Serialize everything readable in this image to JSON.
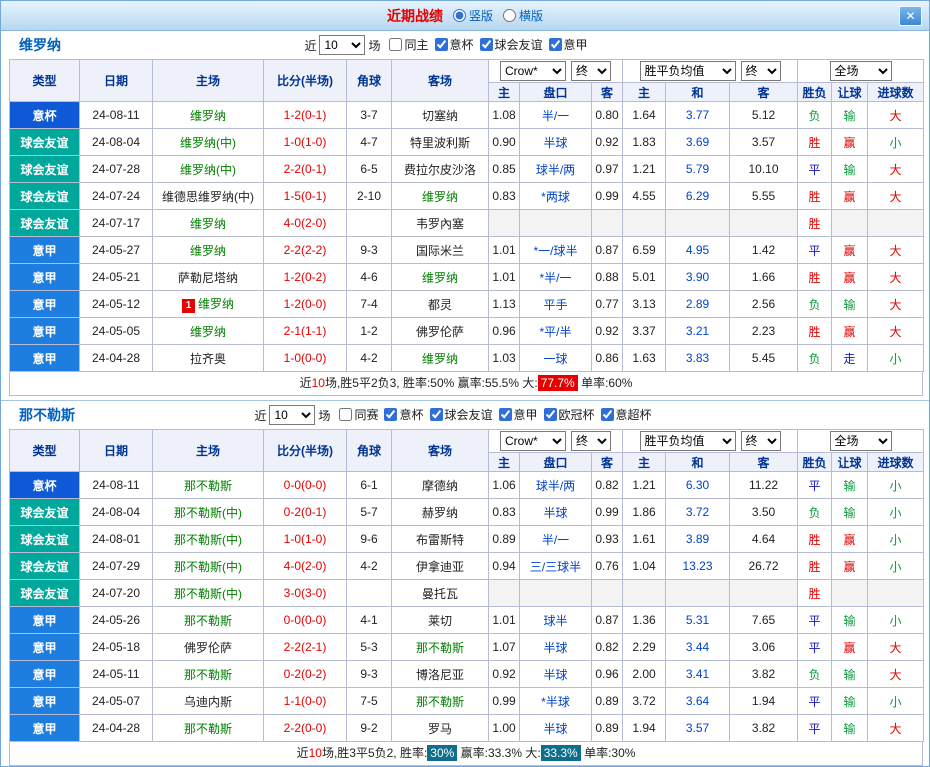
{
  "titlebar": {
    "title": "近期战绩",
    "radio_vertical": "竖版",
    "radio_horizontal": "横版",
    "close_glyph": "✕"
  },
  "columns": {
    "type": "类型",
    "date": "日期",
    "home": "主场",
    "score": "比分(半场)",
    "corner": "角球",
    "away": "客场",
    "odds_home": "主",
    "handicap": "盘口",
    "odds_away": "客",
    "avg_home": "主",
    "avg_draw": "和",
    "avg_away": "客",
    "result": "胜负",
    "handicap_result": "让球",
    "goals": "进球数"
  },
  "selects": {
    "crow": "Crow*",
    "final": "终",
    "avg": "胜平负均值",
    "scope": "全场"
  },
  "colors": {
    "type_bg": {
      "意杯": "#0f58d6",
      "球会友谊": "#00a79b",
      "意甲": "#1e7ee0"
    },
    "result": {
      "胜": "#e60000",
      "平": "#1414c8",
      "负": "#0a9a3c"
    },
    "hres": {
      "赢": "#e60000",
      "输": "#0a9a3c",
      "走": "#1414c8"
    },
    "goals": {
      "大": "#e60000",
      "小": "#0a9a3c"
    },
    "team_green": "#008000",
    "score_red": "#e60000",
    "highlight_red": "#e60000",
    "highlight_dark": "#0f6e8c"
  },
  "sections": [
    {
      "team": "维罗纳",
      "filter": {
        "near": "近",
        "count": "10",
        "games": "场",
        "checkboxes": [
          {
            "label": "同主",
            "checked": false
          },
          {
            "label": "意杯",
            "checked": true
          },
          {
            "label": "球会友谊",
            "checked": true
          },
          {
            "label": "意甲",
            "checked": true
          }
        ]
      },
      "rows": [
        {
          "type": "意杯",
          "date": "24-08-11",
          "home": "维罗纳",
          "hg": true,
          "score": "1-2(0-1)",
          "corner": "3-7",
          "away": "切塞纳",
          "o1": "1.08",
          "hc": "半/一",
          "o2": "0.80",
          "a1": "1.64",
          "a2": "3.77",
          "a3": "5.12",
          "res": "负",
          "hres": "输",
          "goal": "大"
        },
        {
          "type": "球会友谊",
          "date": "24-08-04",
          "home": "维罗纳(中)",
          "hg": true,
          "score": "1-0(1-0)",
          "corner": "4-7",
          "away": "特里波利斯",
          "o1": "0.90",
          "hc": "半球",
          "o2": "0.92",
          "a1": "1.83",
          "a2": "3.69",
          "a3": "3.57",
          "res": "胜",
          "hres": "赢",
          "goal": "小"
        },
        {
          "type": "球会友谊",
          "date": "24-07-28",
          "home": "维罗纳(中)",
          "hg": true,
          "score": "2-2(0-1)",
          "corner": "6-5",
          "away": "费拉尔皮沙洛",
          "o1": "0.85",
          "hc": "球半/两",
          "o2": "0.97",
          "a1": "1.21",
          "a2": "5.79",
          "a3": "10.10",
          "res": "平",
          "hres": "输",
          "goal": "大"
        },
        {
          "type": "球会友谊",
          "date": "24-07-24",
          "home": "维德思维罗纳(中)",
          "score": "1-5(0-1)",
          "corner": "2-10",
          "away": "维罗纳",
          "ag": true,
          "o1": "0.83",
          "hc": "*两球",
          "o2": "0.99",
          "a1": "4.55",
          "a2": "6.29",
          "a3": "5.55",
          "res": "胜",
          "hres": "赢",
          "goal": "大"
        },
        {
          "type": "球会友谊",
          "date": "24-07-17",
          "home": "维罗纳",
          "hg": true,
          "score": "4-0(2-0)",
          "corner": "",
          "away": "韦罗內塞",
          "o1": "",
          "hc": "",
          "o2": "",
          "a1": "",
          "a2": "",
          "a3": "",
          "res": "胜",
          "hres": "",
          "goal": ""
        },
        {
          "type": "意甲",
          "date": "24-05-27",
          "home": "维罗纳",
          "hg": true,
          "score": "2-2(2-2)",
          "corner": "9-3",
          "away": "国际米兰",
          "o1": "1.01",
          "hc": "*一/球半",
          "o2": "0.87",
          "a1": "6.59",
          "a2": "4.95",
          "a3": "1.42",
          "res": "平",
          "hres": "赢",
          "goal": "大"
        },
        {
          "type": "意甲",
          "date": "24-05-21",
          "home": "萨勒尼塔纳",
          "score": "1-2(0-2)",
          "corner": "4-6",
          "away": "维罗纳",
          "ag": true,
          "o1": "1.01",
          "hc": "*半/一",
          "o2": "0.88",
          "a1": "5.01",
          "a2": "3.90",
          "a3": "1.66",
          "res": "胜",
          "hres": "赢",
          "goal": "大"
        },
        {
          "type": "意甲",
          "date": "24-05-12",
          "home": "维罗纳",
          "hg": true,
          "badge": "1",
          "score": "1-2(0-0)",
          "corner": "7-4",
          "away": "都灵",
          "o1": "1.13",
          "hc": "平手",
          "o2": "0.77",
          "a1": "3.13",
          "a2": "2.89",
          "a3": "2.56",
          "res": "负",
          "hres": "输",
          "goal": "大"
        },
        {
          "type": "意甲",
          "date": "24-05-05",
          "home": "维罗纳",
          "hg": true,
          "score": "2-1(1-1)",
          "corner": "1-2",
          "away": "佛罗伦萨",
          "o1": "0.96",
          "hc": "*平/半",
          "o2": "0.92",
          "a1": "3.37",
          "a2": "3.21",
          "a3": "2.23",
          "res": "胜",
          "hres": "赢",
          "goal": "大"
        },
        {
          "type": "意甲",
          "date": "24-04-28",
          "home": "拉齐奥",
          "score": "1-0(0-0)",
          "corner": "4-2",
          "away": "维罗纳",
          "ag": true,
          "o1": "1.03",
          "hc": "一球",
          "o2": "0.86",
          "a1": "1.63",
          "a2": "3.83",
          "a3": "5.45",
          "res": "负",
          "hres": "走",
          "goal": "小"
        }
      ],
      "summary": [
        {
          "t": "近"
        },
        {
          "t": "10",
          "s": "red"
        },
        {
          "t": "场,胜5平2负3, 胜率:50% 赢率:55.5% 大:"
        },
        {
          "t": "77.7%",
          "s": "badge-red"
        },
        {
          "t": " 单率:60%"
        }
      ]
    },
    {
      "team": "那不勒斯",
      "filter": {
        "near": "近",
        "count": "10",
        "games": "场",
        "checkboxes": [
          {
            "label": "同赛",
            "checked": false
          },
          {
            "label": "意杯",
            "checked": true
          },
          {
            "label": "球会友谊",
            "checked": true
          },
          {
            "label": "意甲",
            "checked": true
          },
          {
            "label": "欧冠杯",
            "checked": true
          },
          {
            "label": "意超杯",
            "checked": true
          }
        ]
      },
      "rows": [
        {
          "type": "意杯",
          "date": "24-08-11",
          "home": "那不勒斯",
          "hg": true,
          "score": "0-0(0-0)",
          "corner": "6-1",
          "away": "摩德纳",
          "o1": "1.06",
          "hc": "球半/两",
          "o2": "0.82",
          "a1": "1.21",
          "a2": "6.30",
          "a3": "11.22",
          "res": "平",
          "hres": "输",
          "goal": "小"
        },
        {
          "type": "球会友谊",
          "date": "24-08-04",
          "home": "那不勒斯(中)",
          "hg": true,
          "score": "0-2(0-1)",
          "corner": "5-7",
          "away": "赫罗纳",
          "o1": "0.83",
          "hc": "半球",
          "o2": "0.99",
          "a1": "1.86",
          "a2": "3.72",
          "a3": "3.50",
          "res": "负",
          "hres": "输",
          "goal": "小"
        },
        {
          "type": "球会友谊",
          "date": "24-08-01",
          "home": "那不勒斯(中)",
          "hg": true,
          "score": "1-0(1-0)",
          "corner": "9-6",
          "away": "布雷斯特",
          "o1": "0.89",
          "hc": "半/一",
          "o2": "0.93",
          "a1": "1.61",
          "a2": "3.89",
          "a3": "4.64",
          "res": "胜",
          "hres": "赢",
          "goal": "小"
        },
        {
          "type": "球会友谊",
          "date": "24-07-29",
          "home": "那不勒斯(中)",
          "hg": true,
          "score": "4-0(2-0)",
          "corner": "4-2",
          "away": "伊拿迪亚",
          "o1": "0.94",
          "hc": "三/三球半",
          "o2": "0.76",
          "a1": "1.04",
          "a2": "13.23",
          "a3": "26.72",
          "res": "胜",
          "hres": "赢",
          "goal": "小"
        },
        {
          "type": "球会友谊",
          "date": "24-07-20",
          "home": "那不勒斯(中)",
          "hg": true,
          "score": "3-0(3-0)",
          "corner": "",
          "away": "曼托瓦",
          "o1": "",
          "hc": "",
          "o2": "",
          "a1": "",
          "a2": "",
          "a3": "",
          "res": "胜",
          "hres": "",
          "goal": ""
        },
        {
          "type": "意甲",
          "date": "24-05-26",
          "home": "那不勒斯",
          "hg": true,
          "score": "0-0(0-0)",
          "corner": "4-1",
          "away": "莱切",
          "o1": "1.01",
          "hc": "球半",
          "o2": "0.87",
          "a1": "1.36",
          "a2": "5.31",
          "a3": "7.65",
          "res": "平",
          "hres": "输",
          "goal": "小"
        },
        {
          "type": "意甲",
          "date": "24-05-18",
          "home": "佛罗伦萨",
          "score": "2-2(2-1)",
          "corner": "5-3",
          "away": "那不勒斯",
          "ag": true,
          "o1": "1.07",
          "hc": "半球",
          "o2": "0.82",
          "a1": "2.29",
          "a2": "3.44",
          "a3": "3.06",
          "res": "平",
          "hres": "赢",
          "goal": "大"
        },
        {
          "type": "意甲",
          "date": "24-05-11",
          "home": "那不勒斯",
          "hg": true,
          "score": "0-2(0-2)",
          "corner": "9-3",
          "away": "博洛尼亚",
          "o1": "0.92",
          "hc": "半球",
          "o2": "0.96",
          "a1": "2.00",
          "a2": "3.41",
          "a3": "3.82",
          "res": "负",
          "hres": "输",
          "goal": "大"
        },
        {
          "type": "意甲",
          "date": "24-05-07",
          "home": "乌迪内斯",
          "score": "1-1(0-0)",
          "corner": "7-5",
          "away": "那不勒斯",
          "ag": true,
          "o1": "0.99",
          "hc": "*半球",
          "o2": "0.89",
          "a1": "3.72",
          "a2": "3.64",
          "a3": "1.94",
          "res": "平",
          "hres": "输",
          "goal": "小"
        },
        {
          "type": "意甲",
          "date": "24-04-28",
          "home": "那不勒斯",
          "hg": true,
          "score": "2-2(0-0)",
          "corner": "9-2",
          "away": "罗马",
          "o1": "1.00",
          "hc": "半球",
          "o2": "0.89",
          "a1": "1.94",
          "a2": "3.57",
          "a3": "3.82",
          "res": "平",
          "hres": "输",
          "goal": "大"
        }
      ],
      "summary": [
        {
          "t": "近"
        },
        {
          "t": "10",
          "s": "red"
        },
        {
          "t": "场,胜3平5负2, 胜率:"
        },
        {
          "t": "30%",
          "s": "badge-dark"
        },
        {
          "t": " 赢率:33.3% 大:"
        },
        {
          "t": "33.3%",
          "s": "badge-dark"
        },
        {
          "t": " 单率:30%"
        }
      ]
    }
  ]
}
